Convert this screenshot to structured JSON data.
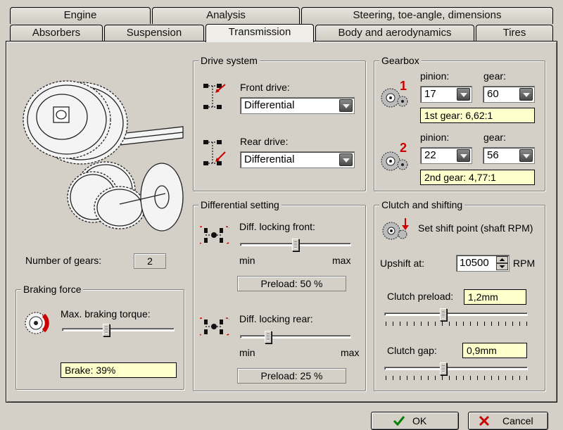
{
  "tabs": {
    "row1": [
      "Engine",
      "Analysis",
      "Steering, toe-angle, dimensions"
    ],
    "row2": [
      "Absorbers",
      "Suspension",
      "Transmission",
      "Body and aerodynamics",
      "Tires"
    ],
    "active": "Transmission"
  },
  "number_of_gears": {
    "label": "Number of gears:",
    "value": "2"
  },
  "braking": {
    "title": "Braking force",
    "torque_label": "Max. braking torque:",
    "slider_fraction": 0.39,
    "readout": "Brake: 39%"
  },
  "drive_system": {
    "title": "Drive system",
    "front_label": "Front drive:",
    "front_value": "Differential",
    "rear_label": "Rear drive:",
    "rear_value": "Differential"
  },
  "gearbox": {
    "title": "Gearbox",
    "pinion_label": "pinion:",
    "gear_label": "gear:",
    "gear1": {
      "num": "1",
      "pinion": "17",
      "gear": "60",
      "ratio": "1st gear: 6,62:1"
    },
    "gear2": {
      "num": "2",
      "pinion": "22",
      "gear": "56",
      "ratio": "2nd gear: 4,77:1"
    }
  },
  "differential": {
    "title": "Differential setting",
    "front_label": "Diff. locking front:",
    "front_fraction": 0.5,
    "front_preload": "Preload: 50 %",
    "rear_label": "Diff. locking rear:",
    "rear_fraction": 0.25,
    "rear_preload": "Preload: 25 %",
    "min": "min",
    "max": "max"
  },
  "clutch": {
    "title": "Clutch and shifting",
    "shift_label": "Set shift point (shaft RPM)",
    "upshift_label": "Upshift at:",
    "upshift_value": "10500",
    "rpm_unit": "RPM",
    "preload_label": "Clutch preload:",
    "preload_value": "1,2mm",
    "preload_fraction": 0.41,
    "gap_label": "Clutch gap:",
    "gap_value": "0,9mm",
    "gap_fraction": 0.41
  },
  "buttons": {
    "ok": "OK",
    "cancel": "Cancel"
  },
  "colors": {
    "accent_red": "#cc0000",
    "readout_bg": "#ffffcc",
    "face": "#d4d0c8"
  }
}
